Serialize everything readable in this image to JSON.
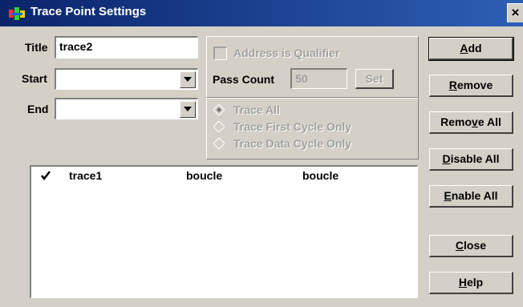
{
  "window": {
    "title": "Trace Point Settings",
    "close_glyph": "×",
    "icon": "app-icon"
  },
  "form": {
    "title_label": "Title",
    "title_value": "trace2",
    "start_label": "Start",
    "start_value": "",
    "end_label": "End",
    "end_value": ""
  },
  "qualifier": {
    "address_label": "Address is Qualifier",
    "address_checked": false,
    "pass_count_label": "Pass Count",
    "pass_count_value": "50",
    "set_label": "Set"
  },
  "trace_mode": {
    "options": [
      {
        "label": "Trace All",
        "selected": true
      },
      {
        "label": "Trace First Cycle Only",
        "selected": false
      },
      {
        "label": "Trace Data Cycle Only",
        "selected": false
      }
    ]
  },
  "list": {
    "rows": [
      {
        "checked": true,
        "name": "trace1",
        "start": "boucle",
        "end": "boucle"
      }
    ]
  },
  "buttons": {
    "add": {
      "prefix": "",
      "mnemonic": "A",
      "suffix": "dd"
    },
    "remove": {
      "prefix": "",
      "mnemonic": "R",
      "suffix": "emove"
    },
    "remove_all": {
      "prefix": "Remo",
      "mnemonic": "v",
      "suffix": "e All"
    },
    "disable_all": {
      "prefix": "",
      "mnemonic": "D",
      "suffix": "isable All"
    },
    "enable_all": {
      "prefix": "",
      "mnemonic": "E",
      "suffix": "nable All"
    },
    "close": {
      "prefix": "",
      "mnemonic": "C",
      "suffix": "lose"
    },
    "help": {
      "prefix": "",
      "mnemonic": "H",
      "suffix": "elp"
    }
  },
  "colors": {
    "titlebar": "#0a246a",
    "face": "#d4d0c8",
    "disabled_text": "#a0a0a0"
  }
}
